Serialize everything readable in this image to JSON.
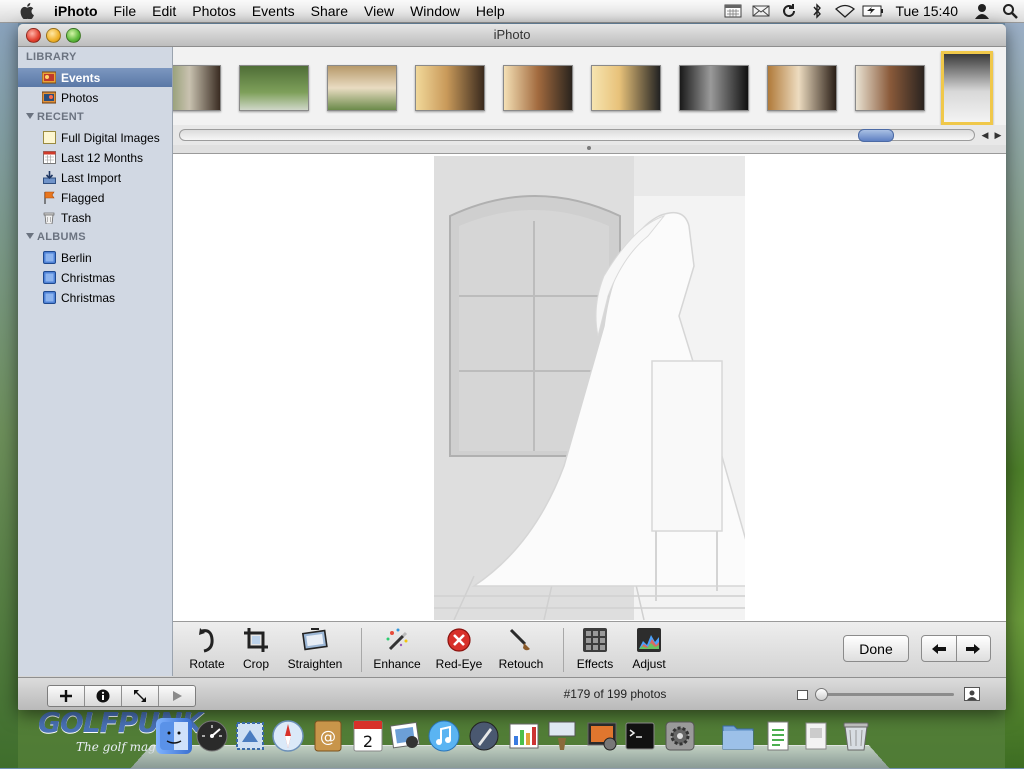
{
  "menubar": {
    "app_name": "iPhoto",
    "menus": [
      "File",
      "Edit",
      "Photos",
      "Events",
      "Share",
      "View",
      "Window",
      "Help"
    ],
    "clock": "Tue 15:40",
    "status_icons": [
      "calendar-icon",
      "mail-icon",
      "sync-icon",
      "bluetooth-icon",
      "wifi-icon",
      "battery-icon",
      "user-icon",
      "spotlight-icon"
    ]
  },
  "window": {
    "title": "iPhoto"
  },
  "sidebar": {
    "library_header": "LIBRARY",
    "library": [
      {
        "label": "Events",
        "icon": "events-icon",
        "selected": true
      },
      {
        "label": "Photos",
        "icon": "photos-icon",
        "selected": false
      }
    ],
    "recent_header": "RECENT",
    "recent": [
      {
        "label": "Full Digital Images",
        "icon": "album-frame-icon"
      },
      {
        "label": "Last 12 Months",
        "icon": "calendar-icon"
      },
      {
        "label": "Last Import",
        "icon": "import-icon"
      },
      {
        "label": "Flagged",
        "icon": "flag-icon"
      },
      {
        "label": "Trash",
        "icon": "trash-icon"
      }
    ],
    "albums_header": "ALBUMS",
    "albums": [
      {
        "label": "Berlin",
        "icon": "album-icon"
      },
      {
        "label": "Christmas",
        "icon": "album-icon"
      },
      {
        "label": "Christmas",
        "icon": "album-icon"
      }
    ]
  },
  "toolbar": {
    "tools": [
      {
        "label": "Rotate",
        "icon": "rotate-icon"
      },
      {
        "label": "Crop",
        "icon": "crop-icon"
      },
      {
        "label": "Straighten",
        "icon": "straighten-icon"
      },
      {
        "label": "Enhance",
        "icon": "enhance-wand-icon"
      },
      {
        "label": "Red-Eye",
        "icon": "red-eye-icon"
      },
      {
        "label": "Retouch",
        "icon": "retouch-brush-icon"
      },
      {
        "label": "Effects",
        "icon": "effects-grid-icon"
      },
      {
        "label": "Adjust",
        "icon": "adjust-histogram-icon"
      }
    ],
    "done_label": "Done"
  },
  "status": {
    "photo_count": "#179 of 199 photos"
  },
  "desktop": {
    "brand": "GOLFPUNK",
    "tagline": "The golf mag"
  },
  "colors": {
    "selection": "#5a78a6",
    "sidebar_bg": "#d1d8e3",
    "thumb_selected_border": "#f0c84a"
  }
}
